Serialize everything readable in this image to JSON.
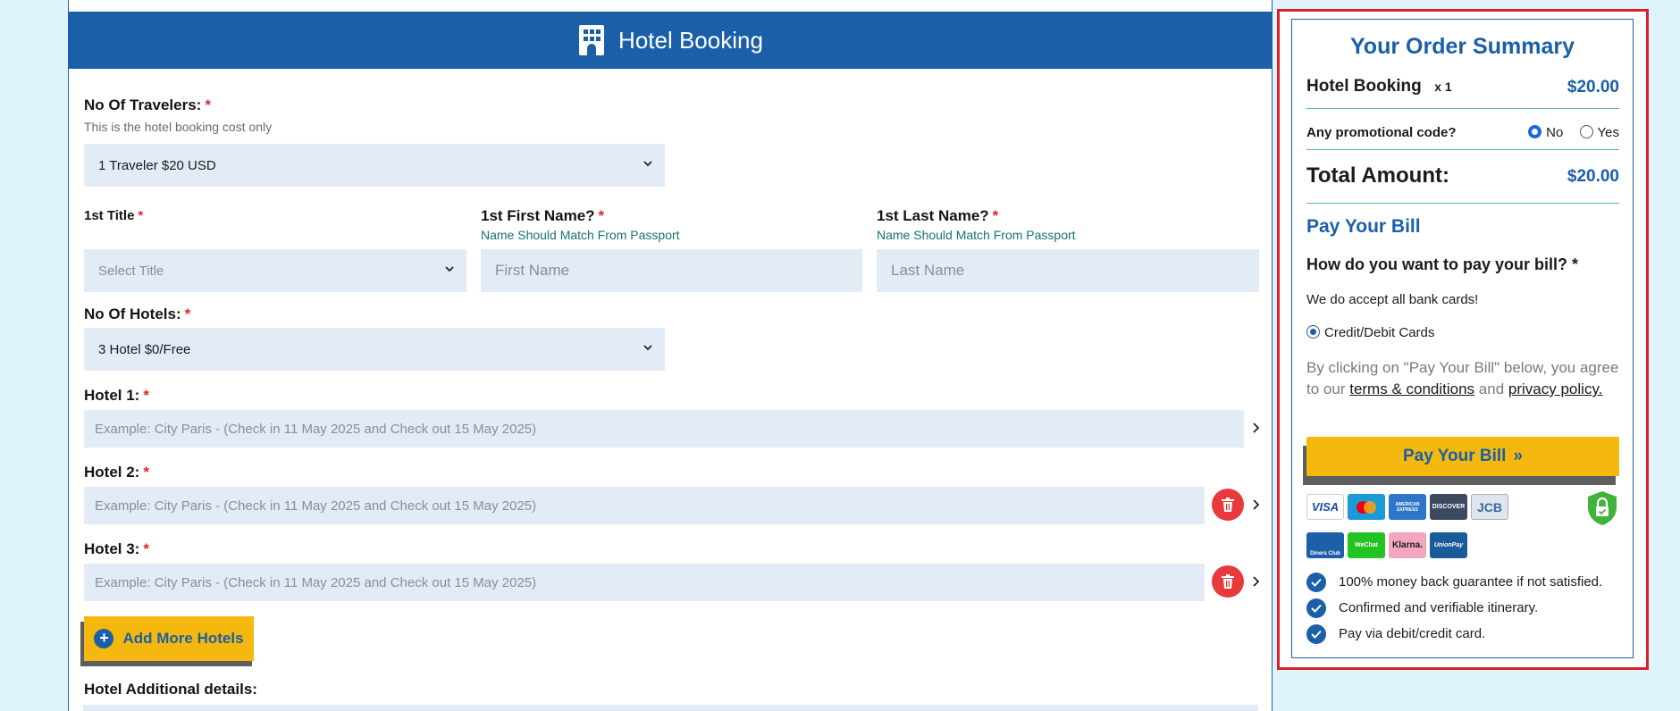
{
  "form": {
    "header_title": "Hotel Booking",
    "travelers": {
      "label": "No Of Travelers:",
      "required": "*",
      "hint": "This is the hotel booking cost only",
      "value": "1 Traveler $20 USD"
    },
    "title_field": {
      "label": "1st Title",
      "required": "*",
      "value": "Select Title"
    },
    "first_name": {
      "label": "1st First Name?",
      "required": "*",
      "hint": "Name Should Match From Passport",
      "placeholder": "First Name"
    },
    "last_name": {
      "label": "1st Last Name?",
      "required": "*",
      "hint": "Name Should Match From Passport",
      "placeholder": "Last Name"
    },
    "hotels_count": {
      "label": "No Of Hotels:",
      "required": "*",
      "value": "3 Hotel $0/Free"
    },
    "hotels": [
      {
        "label": "Hotel 1:",
        "required": "*",
        "placeholder": "Example: City Paris - (Check in 11 May 2025 and Check out 15 May 2025)"
      },
      {
        "label": "Hotel 2:",
        "required": "*",
        "placeholder": "Example: City Paris - (Check in 11 May 2025 and Check out 15 May 2025)"
      },
      {
        "label": "Hotel 3:",
        "required": "*",
        "placeholder": "Example: City Paris - (Check in 11 May 2025 and Check out 15 May 2025)"
      }
    ],
    "add_more_label": "Add More Hotels",
    "add_more_icon": "+",
    "additional_label": "Hotel Additional details:"
  },
  "summary": {
    "title": "Your Order Summary",
    "item_name": "Hotel Booking",
    "item_qty": "x 1",
    "item_price": "$20.00",
    "promo_label": "Any promotional code?",
    "promo_no": "No",
    "promo_yes": "Yes",
    "promo_selected": "No",
    "total_label": "Total Amount:",
    "total_value": "$20.00",
    "pay_heading": "Pay Your Bill",
    "pay_question": "How do you want to pay your bill?",
    "pay_required": "*",
    "accept_text": "We do accept all bank cards!",
    "method_label": "Credit/Debit Cards",
    "terms_prefix": "By clicking on \"Pay Your Bill\" below, you agree to our",
    "terms_link": "terms & conditions",
    "terms_and": "and",
    "privacy_link": "privacy policy.",
    "pay_button": "Pay Your Bill",
    "pay_button_icon": "»",
    "cards": [
      {
        "name": "VISA",
        "color": "#1a4ea6"
      },
      {
        "name": "mastercard",
        "color": "#1a9ad6"
      },
      {
        "name": "AMERICAN EXPRESS",
        "color": "#2e77c8"
      },
      {
        "name": "DISCOVER",
        "color": "#3b4a5e"
      },
      {
        "name": "JCB",
        "color": "#7aa0c8"
      },
      {
        "name": "Diners Club",
        "color": "#1d5fa8"
      },
      {
        "name": "WeChat",
        "color": "#22c322"
      },
      {
        "name": "Klarna.",
        "color": "#f4a6c0"
      },
      {
        "name": "UnionPay",
        "color": "#1a5b9a"
      }
    ],
    "features": [
      "100% money back guarantee if not satisfied.",
      "Confirmed and verifiable itinerary.",
      "Pay via debit/credit card."
    ]
  },
  "colors": {
    "brand_blue": "#1b5fa8",
    "accent_yellow": "#f5b80e",
    "required_red": "#e0262c",
    "delete_red": "#e8393d",
    "highlight_border": "#d8202a"
  }
}
